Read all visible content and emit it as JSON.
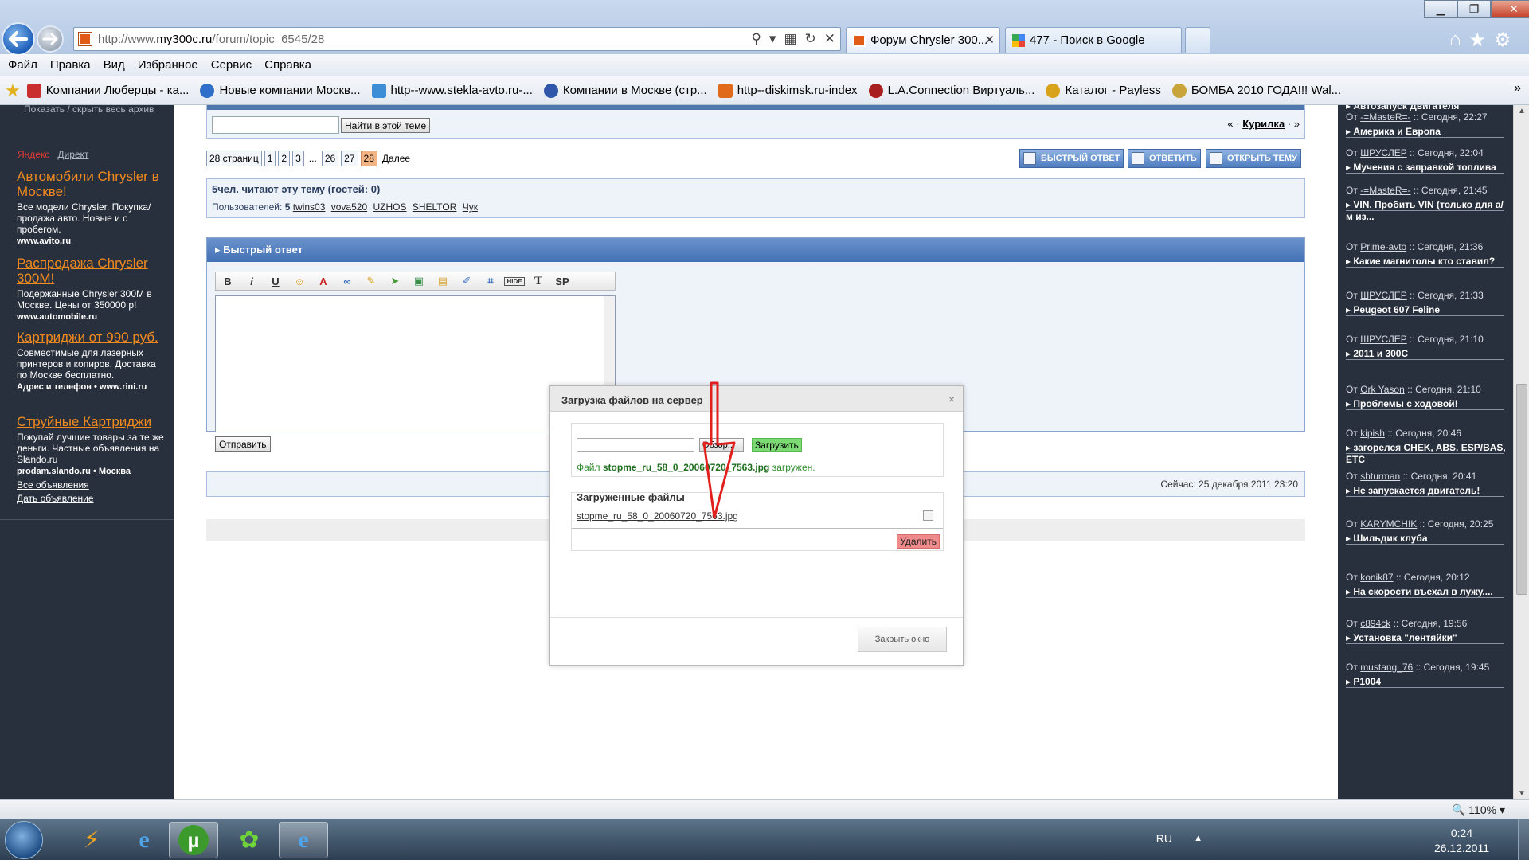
{
  "browser": {
    "url_prefix": "http://www.",
    "url_host": "my300c.ru",
    "url_path": "/forum/topic_6545/28",
    "tabs": [
      {
        "label": "Форум Chrysler 300...",
        "active": true
      },
      {
        "label": "477 - Поиск в Google",
        "active": false
      }
    ],
    "menu": [
      "Файл",
      "Правка",
      "Вид",
      "Избранное",
      "Сервис",
      "Справка"
    ],
    "favorites": [
      {
        "label": "Компании Люберцы - ка...",
        "color": "#c92f2f"
      },
      {
        "label": "Новые компании Москв...",
        "color": "#2f6fc9"
      },
      {
        "label": "http--www.stekla-avto.ru-...",
        "color": "#3c8fd6"
      },
      {
        "label": "Компании в Москве (стр...",
        "color": "#2f56a8"
      },
      {
        "label": "http--diskimsk.ru-index",
        "color": "#e06a1a"
      },
      {
        "label": "L.A.Connection Виртуаль...",
        "color": "#a81f1f"
      },
      {
        "label": "Каталог - Payless",
        "color": "#d9a21c"
      },
      {
        "label": "БОМБА 2010 ГОДА!!! Wal...",
        "color": "#c9a43a"
      }
    ],
    "zoom": "110%"
  },
  "left_sidebar": {
    "archive_toggle": "Показать / скрыть весь архив",
    "yandex": "Яндекс",
    "direct": "Директ",
    "ads": [
      {
        "title": "Автомобили Chrysler в Москве!",
        "text": "Все модели Chrysler. Покупка/продажа авто. Новые и с пробегом.",
        "url": "www.avito.ru"
      },
      {
        "title": "Распродажа Chrysler 300M!",
        "text": "Подержанные Chrysler 300M в Москве. Цены от 350000 р!",
        "url": "www.automobile.ru"
      },
      {
        "title": "Картриджи от 990 руб.",
        "text": "Совместимые для лазерных принтеров и копиров. Доставка по Москве бесплатно.",
        "url": "Адрес и телефон  •  www.rini.ru"
      },
      {
        "title": "Струйные Картриджи",
        "text": "Покупай лучшие товары за те же деньги. Частные объявления на Slando.ru",
        "url": "prodam.slando.ru  •  Москва"
      }
    ],
    "links": [
      "Все объявления",
      "Дать объявление"
    ]
  },
  "forum": {
    "search_button": "Найти в этой теме",
    "nav_prev": "«",
    "nav_topic": "Курилка",
    "nav_next": "»",
    "nav_sep": "·",
    "pager": {
      "pages_label": "28 страниц",
      "items": [
        "1",
        "2",
        "3",
        "...",
        "26",
        "27",
        "28"
      ],
      "current": "28",
      "next": "Далее"
    },
    "buttons": [
      "БЫСТРЫЙ ОТВЕТ",
      "ОТВЕТИТЬ",
      "ОТКРЫТЬ ТЕМУ"
    ],
    "readers_title": "5чел. читают эту тему (гостей: 0)",
    "users_prefix": "Пользователей:",
    "users_count": "5",
    "users": [
      "twins03",
      "vova520",
      "UZHOS",
      "SHELTOR",
      "Чук"
    ],
    "quick_reply_title": "Быстрый ответ",
    "toolbar": [
      "B",
      "i",
      "U",
      "☺",
      "A",
      "∞",
      "✎",
      "➤",
      "▣",
      "▤",
      "✐",
      "⌗",
      "HIDE",
      "T",
      "SP"
    ],
    "send_button": "Отправить",
    "now": "Сейчас: 25 декабря 2011 23:20"
  },
  "dialog": {
    "title": "Загрузка файлов на сервер",
    "close_x": "×",
    "browse": "Обзор...",
    "upload": "Загрузить",
    "msg_prefix": "Файл",
    "msg_file": "stopme_ru_58_0_20060720_7563.jpg",
    "msg_suffix": "загружен.",
    "uploaded_header": "Загруженные файлы",
    "uploaded_file": "stopme_ru_58_0_20060720_7563.jpg",
    "delete": "Удалить",
    "close_window": "Закрыть окно"
  },
  "right_sidebar": [
    {
      "title": "Автозапуск Двигателя",
      "by": "",
      "date": ""
    },
    {
      "title": "Америка и Европа",
      "by": "-=MasteR=-",
      "date": "Сегодня, 22:27"
    },
    {
      "title": "Мучения с заправкой топлива",
      "by": "ШРУСЛЕР",
      "date": "Сегодня, 22:04"
    },
    {
      "title": "VIN. Пробить VIN (только для а/м из...",
      "by": "-=MasteR=-",
      "date": "Сегодня, 21:45"
    },
    {
      "title": "Какие магнитолы кто ставил?",
      "by": "Prime-avto",
      "date": "Сегодня, 21:36"
    },
    {
      "title": "Peugeot 607 Feline",
      "by": "ШРУСЛЕР",
      "date": "Сегодня, 21:33"
    },
    {
      "title": "2011 и 300C",
      "by": "ШРУСЛЕР",
      "date": "Сегодня, 21:10"
    },
    {
      "title": "Проблемы с ходовой!",
      "by": "Ork Yason",
      "date": "Сегодня, 21:10"
    },
    {
      "title": "загорелся CHEK, ABS, ESP/BAS, ETC",
      "by": "kipish",
      "date": "Сегодня, 20:46"
    },
    {
      "title": "Не запускается двигатель!",
      "by": "shturman",
      "date": "Сегодня, 20:41"
    },
    {
      "title": "Шильдик клуба",
      "by": "KARYMCHIK",
      "date": "Сегодня, 20:25"
    },
    {
      "title": "На скорости въехал в лужу....",
      "by": "konik87",
      "date": "Сегодня, 20:12"
    },
    {
      "title": "Установка \"лентяйки\"",
      "by": "c894ck",
      "date": "Сегодня, 19:56"
    },
    {
      "title": "P1004",
      "by": "mustang_76",
      "date": "Сегодня, 19:45"
    }
  ],
  "by_prefix": "От",
  "by_sep": "::",
  "taskbar": {
    "lang": "RU",
    "time": "0:24",
    "date": "26.12.2011"
  }
}
